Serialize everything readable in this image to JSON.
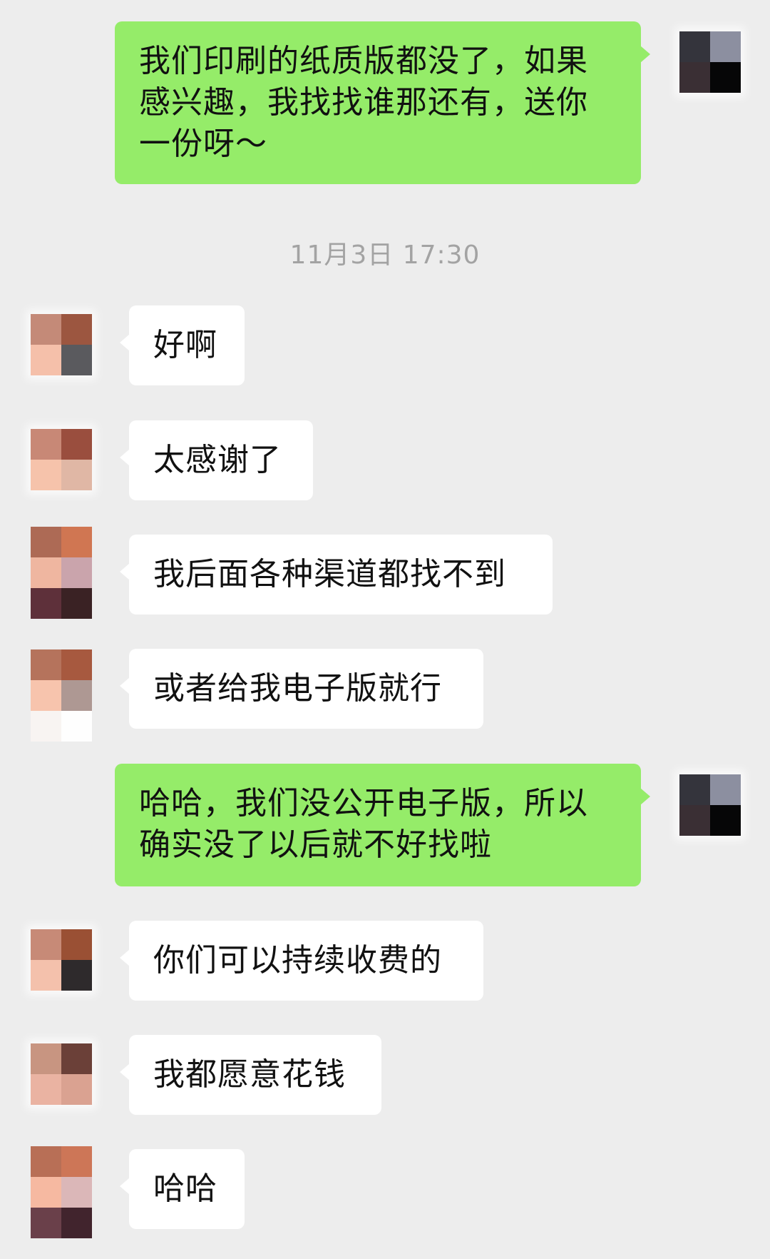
{
  "chat": {
    "timestamp": "11月3日 17:30",
    "messages": [
      {
        "side": "sent",
        "text": "我们印刷的纸质版都没了，如果感兴趣，我找找谁那还有，送你一份呀～"
      },
      {
        "side": "recv",
        "text": "好啊"
      },
      {
        "side": "recv",
        "text": "太感谢了"
      },
      {
        "side": "recv",
        "text": "我后面各种渠道都找不到"
      },
      {
        "side": "recv",
        "text": "或者给我电子版就行"
      },
      {
        "side": "sent",
        "text": "哈哈，我们没公开电子版，所以确实没了以后就不好找啦"
      },
      {
        "side": "recv",
        "text": "你们可以持续收费的"
      },
      {
        "side": "recv",
        "text": "我都愿意花钱"
      },
      {
        "side": "recv",
        "text": "哈哈"
      }
    ]
  },
  "colors": {
    "background": "#ededed",
    "sent_bubble": "#95ec69",
    "received_bubble": "#ffffff",
    "timestamp_text": "#a3a3a3"
  },
  "avatars": {
    "self": {
      "icon": "pixelated-avatar-icon",
      "pixels": [
        "#34343c",
        "#8c8fa0",
        "#3a2f34",
        "#060607"
      ]
    },
    "contact_variants": [
      {
        "icon": "pixelated-avatar-icon",
        "pixels": [
          "#c48a78",
          "#9c5640",
          "#f5c0aa",
          "#5a5a5e"
        ]
      },
      {
        "icon": "pixelated-avatar-icon",
        "pixels": [
          "#c88876",
          "#9a4e3e",
          "#f6c3ab",
          "#e0b7a5"
        ]
      },
      {
        "icon": "pixelated-avatar-icon",
        "pixels": [
          "#ad6a55",
          "#d07652",
          "#efb6a0",
          "#caa4ac",
          "#5e303a",
          "#3a2224"
        ]
      },
      {
        "icon": "pixelated-avatar-icon",
        "pixels": [
          "#b5735c",
          "#a7593f",
          "#f7c4ad",
          "#ae9893",
          "#f8f4f2",
          "#fefefe"
        ]
      },
      {
        "icon": "pixelated-avatar-icon",
        "pixels": [
          "#c78a77",
          "#9a5034",
          "#f4c1ac",
          "#2e2a2c"
        ]
      },
      {
        "icon": "pixelated-avatar-icon",
        "pixels": [
          "#c89581",
          "#6b4038",
          "#eab3a2",
          "#daa291"
        ]
      },
      {
        "icon": "pixelated-avatar-icon",
        "pixels": [
          "#b86f56",
          "#cd7657",
          "#f6b9a1",
          "#dbb7b8",
          "#6a404a",
          "#41242d"
        ]
      }
    ]
  }
}
